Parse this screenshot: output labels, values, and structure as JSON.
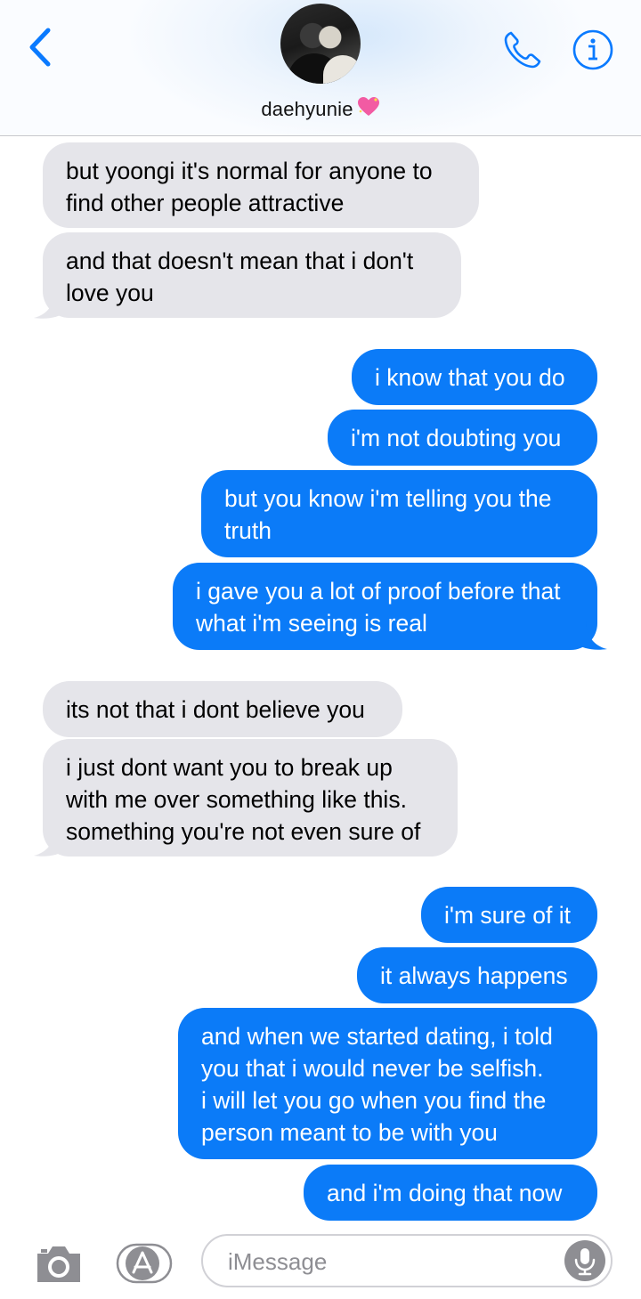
{
  "header": {
    "contact_name": "daehyunie",
    "accent_color": "#0a7aff",
    "icons": [
      "back-chevron-icon",
      "phone-icon",
      "info-icon",
      "sparkling-heart-icon"
    ]
  },
  "messages": [
    {
      "from": "them",
      "lines": [
        "but yoongi it's normal for anyone to",
        "find other people attractive"
      ]
    },
    {
      "from": "them",
      "lines": [
        "and that doesn't mean that i don't",
        "love you"
      ]
    },
    {
      "from": "me",
      "lines": [
        "i know that you do"
      ]
    },
    {
      "from": "me",
      "lines": [
        "i'm not doubting you"
      ]
    },
    {
      "from": "me",
      "lines": [
        "but you know i'm telling you the",
        "truth"
      ]
    },
    {
      "from": "me",
      "lines": [
        "i gave you a lot of proof before that",
        "what i'm seeing is real"
      ]
    },
    {
      "from": "them",
      "lines": [
        "its not that i dont believe you"
      ]
    },
    {
      "from": "them",
      "lines": [
        "i just dont want you to break up",
        "with me over something like this.",
        "something you're not even sure of"
      ]
    },
    {
      "from": "me",
      "lines": [
        "i'm sure of it"
      ]
    },
    {
      "from": "me",
      "lines": [
        "it always happens"
      ]
    },
    {
      "from": "me",
      "lines": [
        "and when we started dating, i told",
        "you that i would never be selfish.",
        "i will let you go when you find the",
        "person meant to be with you"
      ]
    },
    {
      "from": "me",
      "lines": [
        "and i'm doing that now"
      ]
    }
  ],
  "composer": {
    "placeholder": "iMessage",
    "icons": [
      "camera-icon",
      "app-store-icon",
      "microphone-icon"
    ]
  },
  "colors": {
    "sent_bubble": "#0b7bf8",
    "received_bubble": "#e5e5ea"
  }
}
